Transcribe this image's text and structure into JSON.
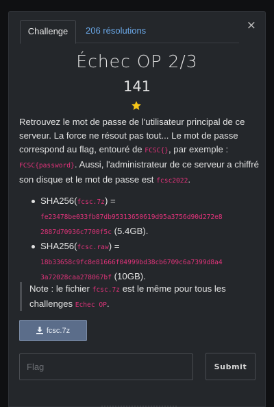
{
  "tabs": {
    "challenge_label": "Challenge",
    "resolutions_label": "206 résolutions"
  },
  "close_label": "×",
  "challenge": {
    "title": "Échec OP 2/3",
    "points": "141",
    "star_color": "#f5c518"
  },
  "description": {
    "p1_a": "Retrouvez le mot de passe de l'utilisateur principal de ce serveur. La force ne résout pas tout... Le mot de passe correspond au flag, entouré de ",
    "code_fcsc": "FCSC{}",
    "p1_b": ", par exemple : ",
    "code_example": "FCSC{password}",
    "p1_c": ". Aussi, l'administrateur de ce serveur a chiffré son disque et le mot de passe est ",
    "code_pw": "fcsc2022",
    "p1_d": "."
  },
  "files": [
    {
      "prefix": "SHA256(",
      "name": "fcsc.7z",
      "suffix": ") =",
      "hash": "fe23478be033fb87db95313650619d95a3756d90d272e82887d70936c7700f5c",
      "size": "(5.4GB)."
    },
    {
      "prefix": "SHA256(",
      "name": "fcsc.raw",
      "suffix": ") =",
      "hash": "18b33658c9fc8e81666f04999bd38cb6709c6a7399d8a43a72028caa278067bf",
      "size": "(10GB)."
    }
  ],
  "note": {
    "text_a": "Note : le fichier ",
    "code_file": "fcsc.7z",
    "text_b": " est le même pour tous les challenges ",
    "code_challenges": "Echec OP",
    "text_c": "."
  },
  "download": {
    "label": "fcsc.7z",
    "icon": "download-icon"
  },
  "flag_form": {
    "placeholder": "Flag",
    "value": "",
    "submit_label": "Submit"
  }
}
